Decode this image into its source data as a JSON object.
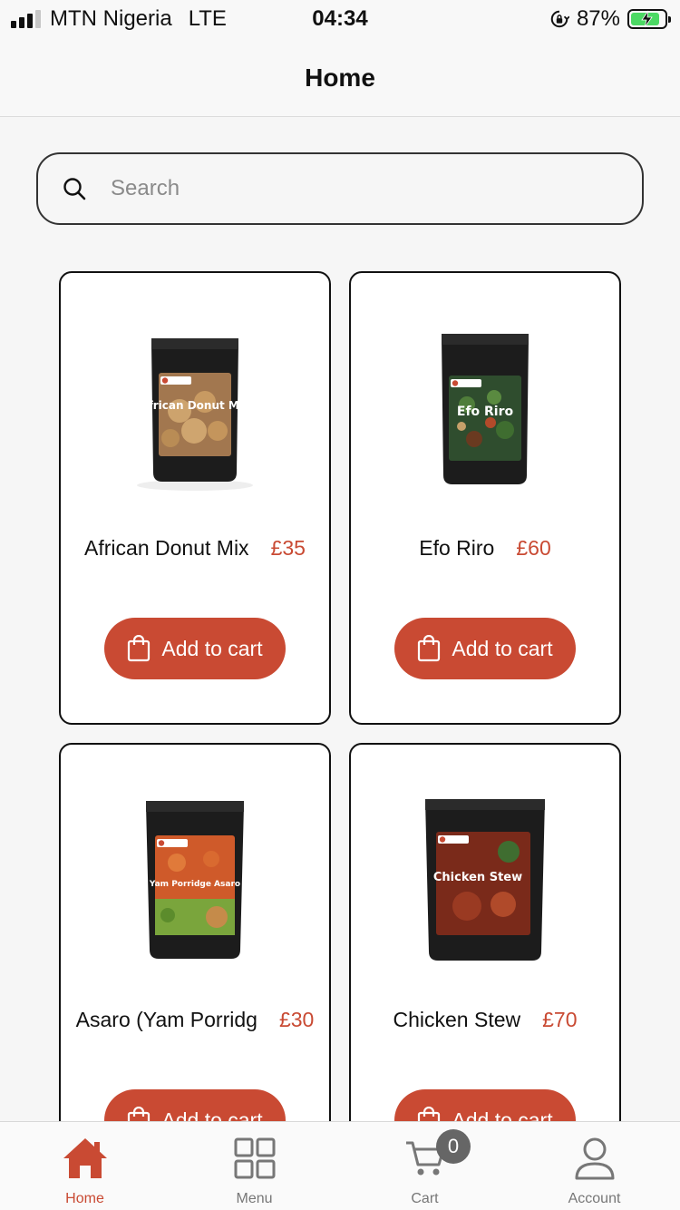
{
  "status_bar": {
    "carrier": "MTN Nigeria",
    "network": "LTE",
    "time": "04:34",
    "battery": "87%",
    "battery_level": 0.87
  },
  "header": {
    "title": "Home"
  },
  "search": {
    "placeholder": "Search",
    "value": ""
  },
  "products": [
    {
      "name": "African Donut Mix",
      "price": "£35",
      "add_label": "Add to cart",
      "image": "african-donut-mix-pack",
      "image_text": "African Donut Mix"
    },
    {
      "name": "Efo Riro",
      "price": "£60",
      "add_label": "Add to cart",
      "image": "efo-riro-pack",
      "image_text": "Efo Riro"
    },
    {
      "name": "Asaro (Yam Porridg",
      "price": "£30",
      "add_label": "Add to cart",
      "image": "asaro-pack",
      "image_text": "Yam Porridge Asaro"
    },
    {
      "name": "Chicken Stew",
      "price": "£70",
      "add_label": "Add to cart",
      "image": "chicken-stew-pack",
      "image_text": "Chicken Stew"
    }
  ],
  "tabbar": {
    "items": [
      {
        "label": "Home",
        "icon": "home-icon",
        "active": true
      },
      {
        "label": "Menu",
        "icon": "grid-icon",
        "active": false
      },
      {
        "label": "Cart",
        "icon": "cart-icon",
        "active": false,
        "badge": "0"
      },
      {
        "label": "Account",
        "icon": "user-icon",
        "active": false
      }
    ]
  },
  "colors": {
    "accent": "#c94a33",
    "background": "#f6f6f6",
    "text": "#111111",
    "inactive": "#777777"
  }
}
